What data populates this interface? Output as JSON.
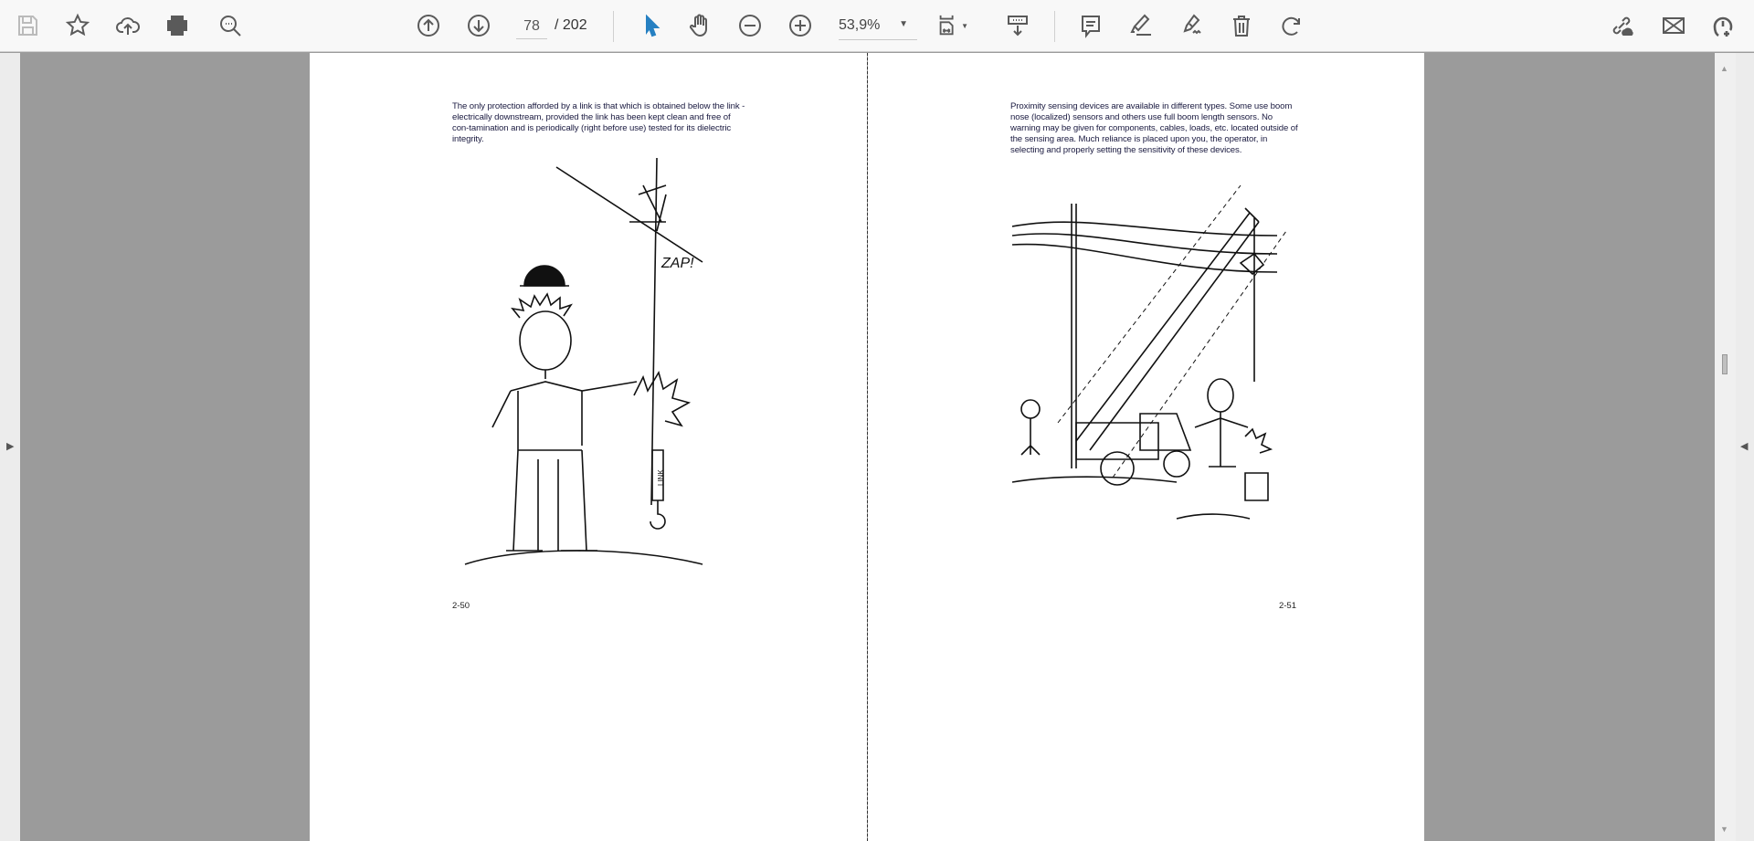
{
  "toolbar": {
    "left_icons": [
      "save-icon",
      "bookmark-star-icon",
      "upload-cloud-icon",
      "print-icon",
      "find-icon"
    ],
    "page_current": "78",
    "page_total": "/ 202",
    "zoom": "53,9%",
    "right_icons": [
      "share-link-icon",
      "email-icon",
      "add-user-icon"
    ]
  },
  "document": {
    "left_page": {
      "text": "The only protection afforded by a link is that which is obtained below the link -electrically downstream, provided the link has been kept clean and free of con-tamination and is periodically (right before use) tested for its dielectric integrity.",
      "illustration_text": "ZAP!",
      "hook_label": "LINK",
      "page_number": "2-50"
    },
    "right_page": {
      "text": "Proximity sensing devices are available in different types. Some use boom nose (localized) sensors and others use full boom length sensors. No warning may be given for components, cables, loads, etc. located outside of the sensing area. Much reliance is placed upon you, the operator, in selecting and properly setting the sensitivity of these devices.",
      "page_number": "2-51"
    }
  },
  "colors": {
    "select_tool": "#2680c2",
    "toolbar_bg": "#f8f8f8",
    "viewer_bg": "#9b9b9b"
  }
}
